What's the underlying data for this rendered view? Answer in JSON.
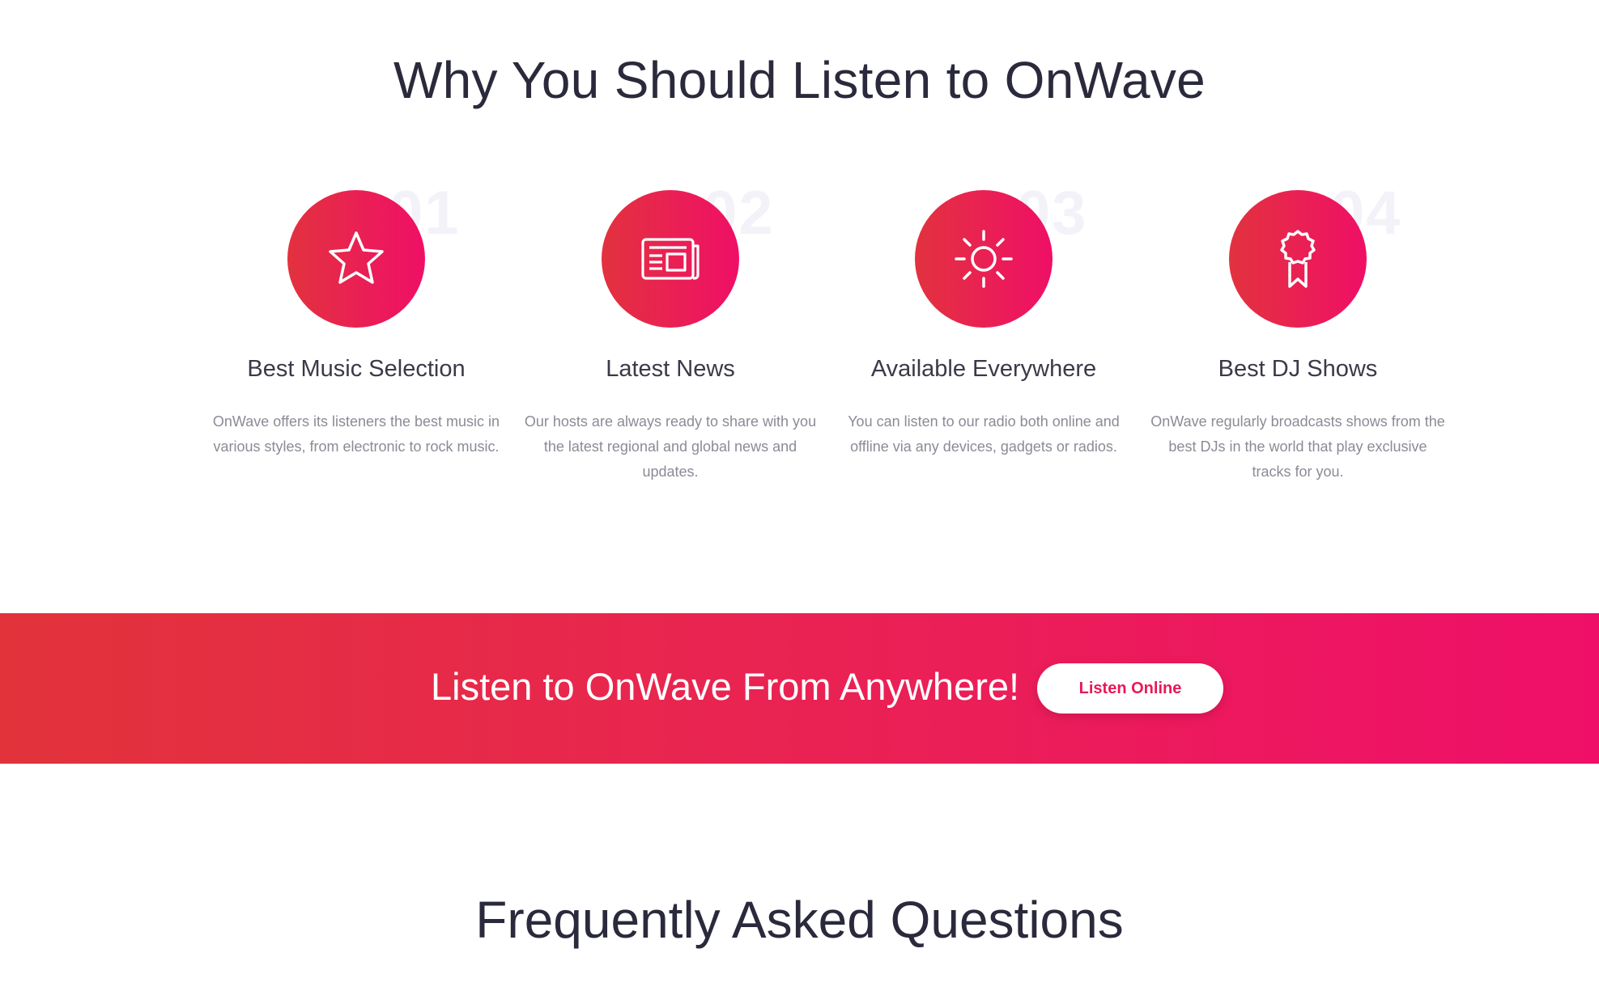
{
  "why_section": {
    "title": "Why You Should Listen to OnWave",
    "features": [
      {
        "number": "01",
        "icon": "star-icon",
        "title": "Best Music Selection",
        "description": "OnWave offers its listeners the best music in various styles, from electronic to rock music."
      },
      {
        "number": "02",
        "icon": "newspaper-icon",
        "title": "Latest News",
        "description": "Our hosts are always ready to share with you the latest regional and global news and updates."
      },
      {
        "number": "03",
        "icon": "sun-icon",
        "title": "Available Everywhere",
        "description": "You can listen to our radio both online and offline via any devices, gadgets or radios."
      },
      {
        "number": "04",
        "icon": "award-ribbon-icon",
        "title": "Best DJ Shows",
        "description": "OnWave regularly broadcasts shows from the best DJs in the world that play exclusive tracks for you."
      }
    ]
  },
  "cta_banner": {
    "text": "Listen to OnWave From Anywhere!",
    "button_label": "Listen Online"
  },
  "faq_section": {
    "title": "Frequently Asked Questions"
  },
  "colors": {
    "accent_start": "#e2323e",
    "accent_end": "#ef0f66",
    "heading": "#2a2a3c",
    "body_text": "#8b8b96",
    "number_watermark": "#f3f2f8"
  }
}
